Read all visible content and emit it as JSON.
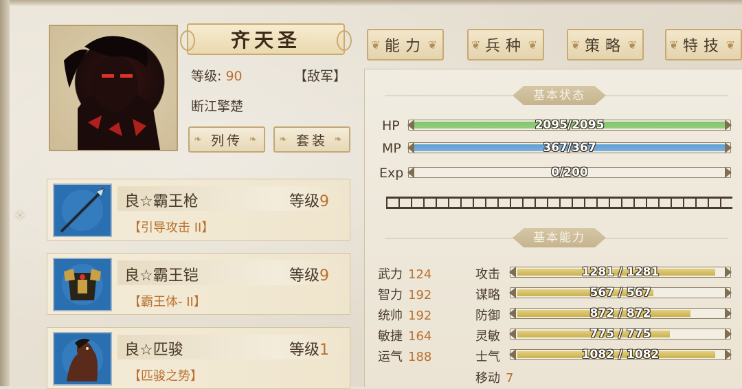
{
  "hero": {
    "name": "齐天圣",
    "level_label": "等级:",
    "level_value": "90",
    "faction": "【敌军】",
    "title": "断江擎楚"
  },
  "buttons": {
    "biography": "列传",
    "outfit": "套装"
  },
  "tabs": [
    "能力",
    "兵种",
    "策略",
    "特技"
  ],
  "equipment": [
    {
      "name": "良☆霸王枪",
      "level_label": "等级",
      "level": "9",
      "skill": "【引导攻击 II】",
      "icon": "spear-icon"
    },
    {
      "name": "良☆霸王铠",
      "level_label": "等级",
      "level": "9",
      "skill": "【霸王体- II】",
      "icon": "armor-icon"
    },
    {
      "name": "良☆匹骏",
      "level_label": "等级",
      "level": "1",
      "skill": "【匹骏之势】",
      "icon": "horse-icon"
    }
  ],
  "basic_status": {
    "heading": "基本状态",
    "hp": {
      "label": "HP",
      "text": "2095/2095",
      "fraction": 1.0,
      "color": "#7fc46a"
    },
    "mp": {
      "label": "MP",
      "text": "367/367",
      "fraction": 1.0,
      "color": "#5e9fd6"
    },
    "exp": {
      "label": "Exp",
      "text": "0/200",
      "fraction": 0.0
    }
  },
  "basic_ability": {
    "heading": "基本能力",
    "attributes": [
      {
        "label": "武力",
        "value": "124"
      },
      {
        "label": "智力",
        "value": "192"
      },
      {
        "label": "统帅",
        "value": "192"
      },
      {
        "label": "敏捷",
        "value": "164"
      },
      {
        "label": "运气",
        "value": "188"
      }
    ],
    "combat": [
      {
        "label": "攻击",
        "text": "1281 / 1281",
        "fraction": 0.96
      },
      {
        "label": "谋略",
        "text": "567 / 567",
        "fraction": 0.66
      },
      {
        "label": "防御",
        "text": "872 / 872",
        "fraction": 0.84
      },
      {
        "label": "灵敏",
        "text": "775 / 775",
        "fraction": 0.74
      },
      {
        "label": "士气",
        "text": "1082 / 1082",
        "fraction": 0.96
      }
    ],
    "move": {
      "label": "移动",
      "value": "7"
    }
  }
}
